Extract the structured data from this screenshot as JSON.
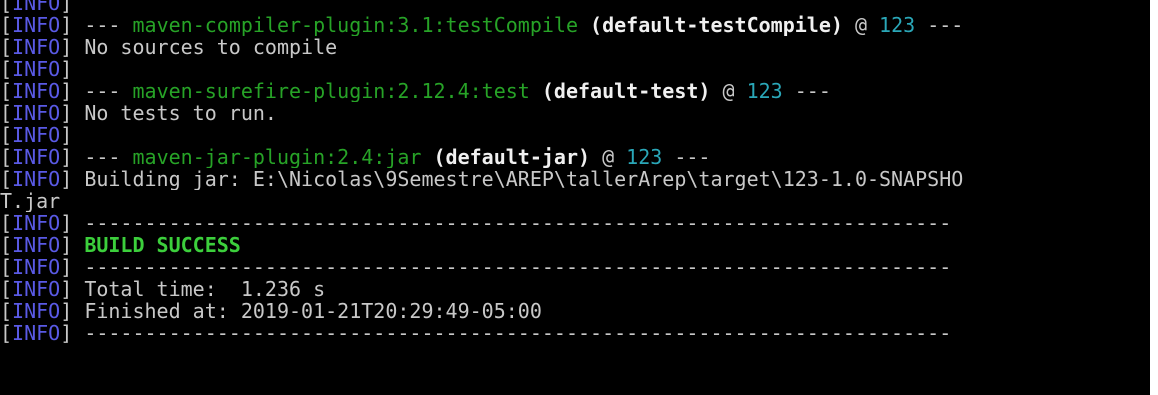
{
  "terminal": {
    "prefix_open": "[",
    "prefix_close": "]",
    "level": "INFO",
    "lines": [
      {
        "type": "info_only"
      },
      {
        "type": "plugin",
        "sep_left": "--- ",
        "plugin": "maven-compiler-plugin:3.1:testCompile",
        "exec": " (default-testCompile)",
        "at": " @ ",
        "artifact": "123",
        "sep_right": " ---"
      },
      {
        "type": "text",
        "text": "No sources to compile"
      },
      {
        "type": "info_only"
      },
      {
        "type": "plugin",
        "sep_left": "--- ",
        "plugin": "maven-surefire-plugin:2.12.4:test",
        "exec": " (default-test)",
        "at": " @ ",
        "artifact": "123",
        "sep_right": " ---"
      },
      {
        "type": "text",
        "text": "No tests to run."
      },
      {
        "type": "info_only"
      },
      {
        "type": "plugin",
        "sep_left": "--- ",
        "plugin": "maven-jar-plugin:2.4:jar",
        "exec": " (default-jar)",
        "at": " @ ",
        "artifact": "123",
        "sep_right": " ---"
      },
      {
        "type": "text",
        "text": "Building jar: E:\\Nicolas\\9Semestre\\AREP\\tallerArep\\target\\123-1.0-SNAPSHO"
      },
      {
        "type": "raw",
        "text": "T.jar"
      },
      {
        "type": "text",
        "text": "------------------------------------------------------------------------"
      },
      {
        "type": "success",
        "text": "BUILD SUCCESS"
      },
      {
        "type": "text",
        "text": "------------------------------------------------------------------------"
      },
      {
        "type": "text",
        "text": "Total time:  1.236 s"
      },
      {
        "type": "text",
        "text": "Finished at: 2019-01-21T20:29:49-05:00"
      },
      {
        "type": "text",
        "text": "------------------------------------------------------------------------"
      }
    ]
  },
  "colors": {
    "background": "#000000",
    "info_tag": "#5a5ae6",
    "plugin": "#27a327",
    "artifact": "#2aa7b8",
    "success": "#3ccf3c",
    "text": "#c8c8c8"
  }
}
